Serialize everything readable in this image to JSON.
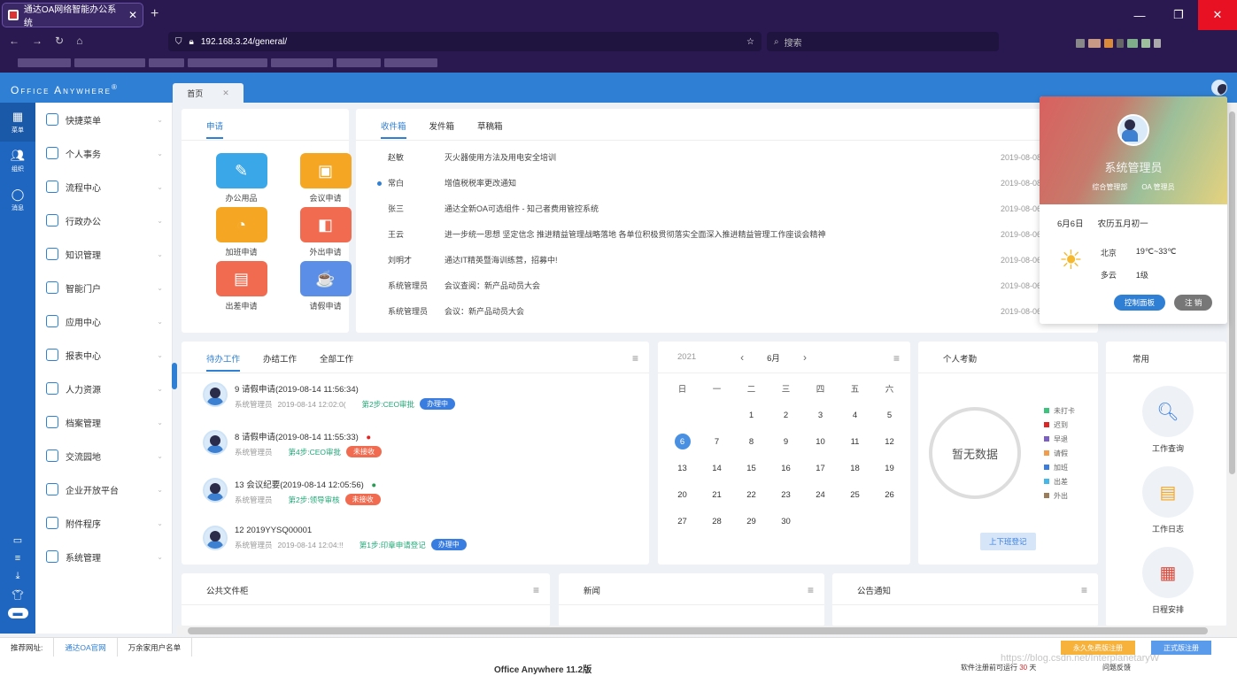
{
  "browser": {
    "tab_title": "通达OA网络智能办公系统",
    "url": "192.168.3.24/general/",
    "search_placeholder": "搜索",
    "colors": {
      "chrome": "#2a1850"
    }
  },
  "app": {
    "logo": "Office Anywhere",
    "logo_mark": "®",
    "home_tab": "首页",
    "accent": "#2f7fd4"
  },
  "rail": [
    {
      "icon": "grid-icon",
      "label": "菜单"
    },
    {
      "icon": "people-icon",
      "label": "组织"
    },
    {
      "icon": "chat-icon",
      "label": "消息"
    }
  ],
  "menu": [
    "快捷菜单",
    "个人事务",
    "流程中心",
    "行政办公",
    "知识管理",
    "智能门户",
    "应用中心",
    "报表中心",
    "人力资源",
    "档案管理",
    "交流园地",
    "企业开放平台",
    "附件程序",
    "系统管理"
  ],
  "apply": {
    "tab": "申请",
    "apps": [
      {
        "label": "办公用品",
        "color": "#3aa8e8",
        "glyph": "✎"
      },
      {
        "label": "会议申请",
        "color": "#f5a623",
        "glyph": "▣"
      },
      {
        "label": "加班申请",
        "color": "#f5a623",
        "glyph": "◔"
      },
      {
        "label": "外出申请",
        "color": "#f06b4f",
        "glyph": "◧"
      },
      {
        "label": "出差申请",
        "color": "#f06b4f",
        "glyph": "▤"
      },
      {
        "label": "请假申请",
        "color": "#5b8ee6",
        "glyph": "☕"
      }
    ]
  },
  "mail": {
    "tabs": [
      "收件箱",
      "发件箱",
      "草稿箱"
    ],
    "rows": [
      {
        "from": "赵敏",
        "subject": "灭火器使用方法及用电安全培训",
        "date": "2019-08-08 14:44",
        "unread": false
      },
      {
        "from": "常白",
        "subject": "增值税税率更改通知",
        "date": "2019-08-08 14:36",
        "unread": true
      },
      {
        "from": "张三",
        "subject": "通达全新OA可选组件 - 知己者费用管控系统",
        "date": "2019-08-06 15:33",
        "unread": false
      },
      {
        "from": "王云",
        "subject": "进一步统一思想 坚定信念 推进精益管理战略落地 各单位积极贯彻落实全面深入推进精益管理工作座谈会精神",
        "date": "2019-08-06 15:31",
        "unread": false
      },
      {
        "from": "刘明才",
        "subject": "通达IT精英暨海训练营，招募中!",
        "date": "2019-08-06 15:29",
        "unread": false
      },
      {
        "from": "系统管理员",
        "subject": "会议查阅：新产品动员大会",
        "date": "2019-08-06 10:11",
        "unread": false
      },
      {
        "from": "系统管理员",
        "subject": "会议：新产品动员大会",
        "date": "2019-08-06 10:11",
        "unread": false
      }
    ]
  },
  "work": {
    "tabs": [
      "待办工作",
      "办结工作",
      "全部工作"
    ],
    "items": [
      {
        "num": "9",
        "title": "请假申请(2019-08-14 11:56:34)",
        "user": "系统管理员",
        "time": "2019-08-14 12:02:0(",
        "step": "第2步:CEO审批",
        "status": "办理中",
        "status_color": "#3a7de0",
        "flag": ""
      },
      {
        "num": "8",
        "title": "请假申请(2019-08-14 11:55:33)",
        "user": "系统管理员",
        "time": "",
        "step": "第4步:CEO审批",
        "status": "未接收",
        "status_color": "#f06b4f",
        "flag": "red"
      },
      {
        "num": "13",
        "title": "会议纪要(2019-08-14 12:05:56)",
        "user": "系统管理员",
        "time": "",
        "step": "第2步:领导审核",
        "status": "未接收",
        "status_color": "#f06b4f",
        "flag": "green"
      },
      {
        "num": "12",
        "title": "2019YYSQ00001",
        "user": "系统管理员",
        "time": "2019-08-14 12:04:!!",
        "step": "第1步:印章申请登记",
        "status": "办理中",
        "status_color": "#3a7de0",
        "flag": ""
      }
    ]
  },
  "calendar": {
    "year": "2021",
    "month": "6月",
    "weekdays": [
      "日",
      "一",
      "二",
      "三",
      "四",
      "五",
      "六"
    ],
    "days": [
      "",
      "",
      "1",
      "2",
      "3",
      "4",
      "5",
      "6",
      "7",
      "8",
      "9",
      "10",
      "11",
      "12",
      "13",
      "14",
      "15",
      "16",
      "17",
      "18",
      "19",
      "20",
      "21",
      "22",
      "23",
      "24",
      "25",
      "26",
      "27",
      "28",
      "29",
      "30",
      "",
      "",
      ""
    ],
    "today": "6"
  },
  "attendance": {
    "title": "个人考勤",
    "empty": "暂无数据",
    "button": "上下班登记",
    "legend": [
      {
        "label": "未打卡",
        "color": "#3cc47c"
      },
      {
        "label": "迟到",
        "color": "#e02424"
      },
      {
        "label": "早退",
        "color": "#7b5fc7"
      },
      {
        "label": "请假",
        "color": "#f39c4a"
      },
      {
        "label": "加班",
        "color": "#3a7de0"
      },
      {
        "label": "出差",
        "color": "#44b8e8"
      },
      {
        "label": "外出",
        "color": "#9b7d5a"
      }
    ]
  },
  "common": {
    "title": "常用",
    "items": [
      {
        "label": "工作查询",
        "icon": "doc-search-icon"
      },
      {
        "label": "工作日志",
        "icon": "notebook-icon"
      },
      {
        "label": "日程安排",
        "icon": "calendar-icon"
      }
    ]
  },
  "bottom_cards": [
    "公共文件柜",
    "新闻",
    "公告通知"
  ],
  "user": {
    "name": "系统管理员",
    "dept": "综合管理部",
    "role": "OA 管理员",
    "date": "6月6日",
    "lunar": "农历五月初一",
    "city": "北京",
    "temp": "19℃~33℃",
    "weather": "多云",
    "wind": "1级",
    "btn_panel": "控制面板",
    "btn_logout": "注 销"
  },
  "links": [
    "推荐网址:",
    "通达OA官网",
    "万余家用户名单"
  ],
  "footer": {
    "product": "Office Anywhere 11.2版",
    "license_prefix": "软件注册前可运行",
    "license_days": "30",
    "license_suffix": "天",
    "feedback": "问题反馈",
    "btn_trial": "永久免费版注册",
    "btn_reg": "正式版注册",
    "watermark": "https://blog.csdn.net/InterplanetaryW"
  }
}
